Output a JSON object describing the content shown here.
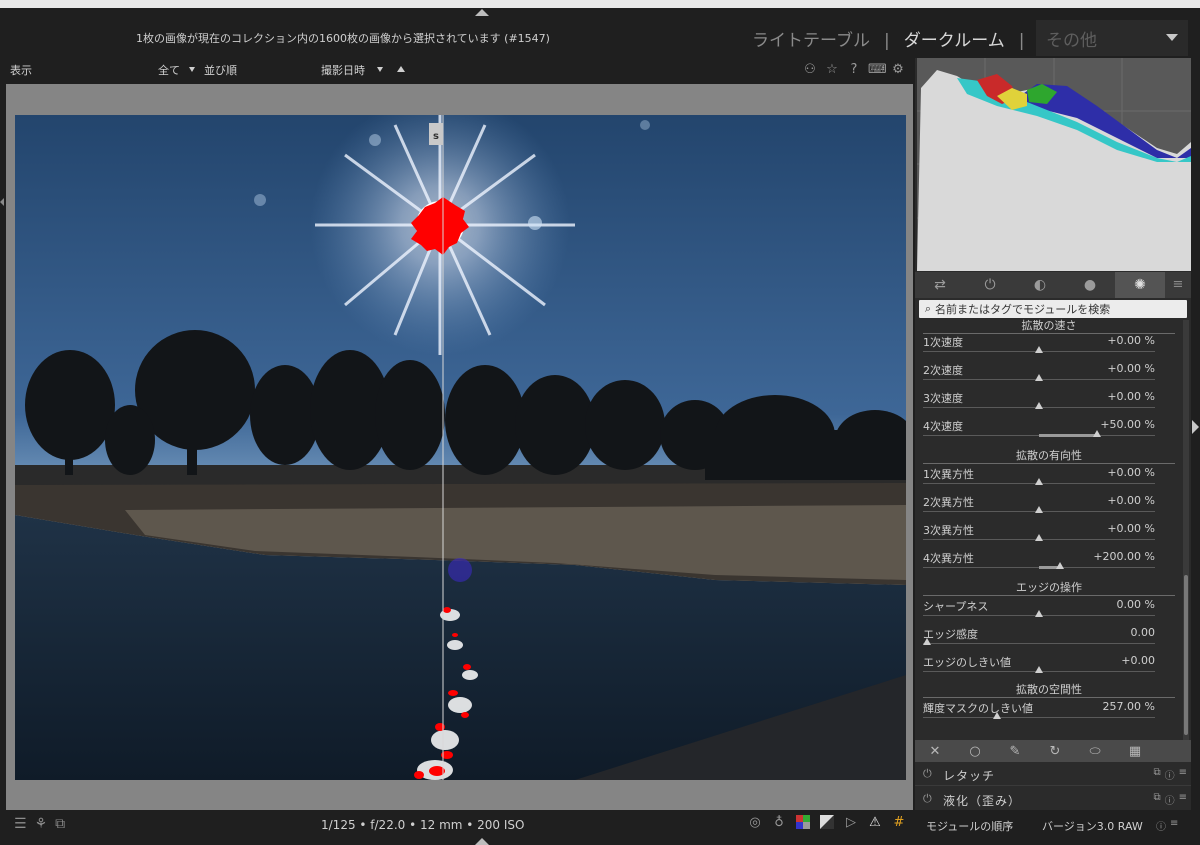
{
  "topbar": {
    "collection_info": "1枚の画像が現在のコレクション内の1600枚の画像から選択されています (#1547)",
    "views": {
      "lighttable": "ライトテーブル",
      "darkroom": "ダークルーム",
      "separator": "|",
      "other": "その他"
    }
  },
  "filter": {
    "display": "表示",
    "all": "全て",
    "sort_label": "並び順",
    "sort_value": "撮影日時"
  },
  "photo": {
    "split_marker": "s"
  },
  "module_search": {
    "placeholder": "名前またはタグでモジュールを検索"
  },
  "module_tabs": [
    "active-modules",
    "base",
    "tone",
    "color",
    "effects"
  ],
  "params": {
    "sections": [
      {
        "title": "拡散の速さ"
      },
      {
        "title": "拡散の有向性"
      },
      {
        "title": "エッジの操作"
      },
      {
        "title": "拡散の空間性"
      }
    ],
    "rows": [
      {
        "label": "1次速度",
        "value": "+0.00 %",
        "pos": 0.5
      },
      {
        "label": "2次速度",
        "value": "+0.00 %",
        "pos": 0.5
      },
      {
        "label": "3次速度",
        "value": "+0.00 %",
        "pos": 0.5
      },
      {
        "label": "4次速度",
        "value": "+50.00 %",
        "pos": 0.75
      },
      {
        "label": "1次異方性",
        "value": "+0.00 %",
        "pos": 0.5
      },
      {
        "label": "2次異方性",
        "value": "+0.00 %",
        "pos": 0.5
      },
      {
        "label": "3次異方性",
        "value": "+0.00 %",
        "pos": 0.5
      },
      {
        "label": "4次異方性",
        "value": "+200.00 %",
        "pos": 0.59
      },
      {
        "label": "シャープネス",
        "value": "0.00 %",
        "pos": 0.5
      },
      {
        "label": "エッジ感度",
        "value": "0.00",
        "pos": 0.0
      },
      {
        "label": "エッジのしきい値",
        "value": "+0.00",
        "pos": 0.5
      },
      {
        "label": "輝度マスクのしきい値",
        "value": "257.00 %",
        "pos": 0.32
      }
    ]
  },
  "tools": [
    "off",
    "circle",
    "brush",
    "path",
    "ellipse",
    "pattern"
  ],
  "modules": [
    {
      "name": "レタッチ"
    },
    {
      "name": "液化（歪み）"
    }
  ],
  "bottombar": {
    "exif": "1/125 • f/22.0 • 12 mm • 200 ISO",
    "module_order_label": "モジュールの順序",
    "module_order_value": "バージョン3.0 RAW"
  }
}
